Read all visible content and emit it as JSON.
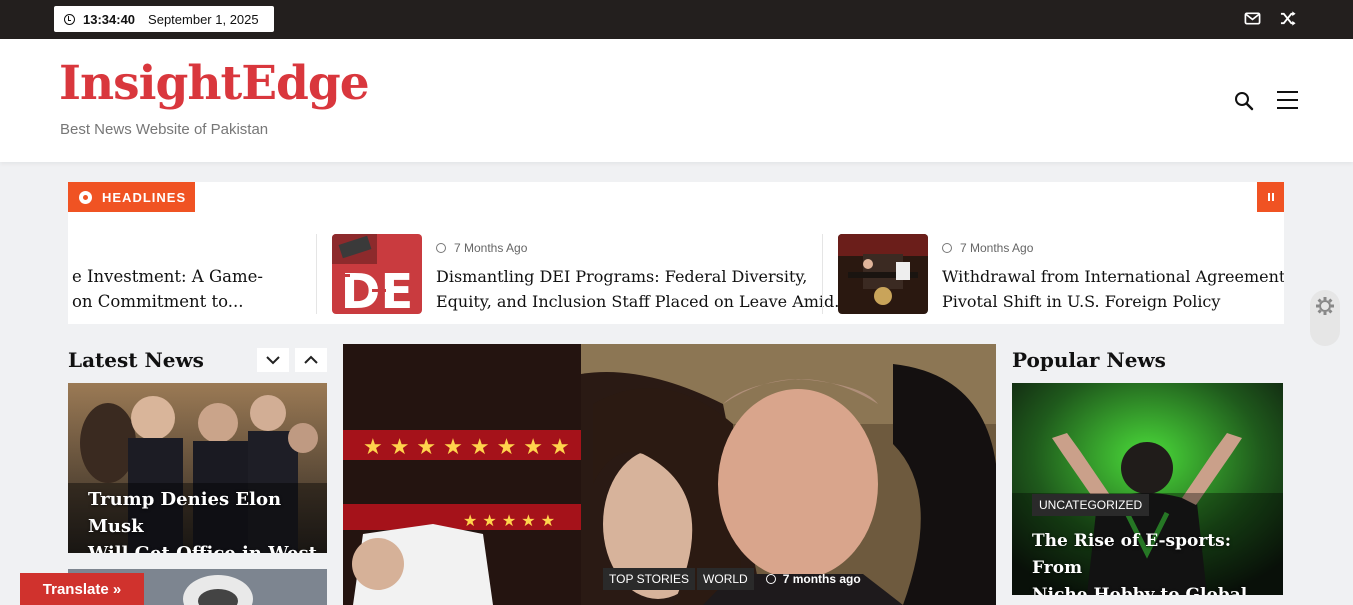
{
  "topbar": {
    "time": "13:34:40",
    "date": "September 1, 2025",
    "icons": [
      "clock-icon",
      "mail-icon",
      "shuffle-icon"
    ]
  },
  "header": {
    "logo": "InsightEdge",
    "tagline": "Best News Website of Pakistan",
    "icons": [
      "search-icon",
      "hamburger-menu-icon"
    ]
  },
  "headlines": {
    "label": "HEADLINES",
    "items": [
      {
        "title_line1": "e Investment: A Game-",
        "title_line2": "on Commitment to..."
      },
      {
        "meta": "7 Months Ago",
        "title_line1": "Dismantling DEI Programs: Federal Diversity,",
        "title_line2": "Equity, and Inclusion Staff Placed on Leave Amid..."
      },
      {
        "meta": "7 Months Ago",
        "title_line1": "Withdrawal from International Agreements: A",
        "title_line2": "Pivotal Shift in U.S. Foreign Policy"
      }
    ]
  },
  "latest": {
    "title": "Latest News",
    "card1": {
      "title_line1": "Trump Denies Elon Musk",
      "title_line2": "Will Get Office in West"
    }
  },
  "feature": {
    "tags": [
      "TOP STORIES",
      "WORLD"
    ],
    "meta": "7 months ago"
  },
  "popular": {
    "title": "Popular News",
    "card1": {
      "category": "UNCATEGORIZED",
      "title_line1": "The Rise of E-sports: From",
      "title_line2": "Niche Hobby to Global"
    }
  },
  "translate": {
    "label": "Translate »"
  },
  "colors": {
    "brand": "#d9373d",
    "accent": "#f05323",
    "topbar": "#231f1e",
    "translate": "#d0322d"
  }
}
